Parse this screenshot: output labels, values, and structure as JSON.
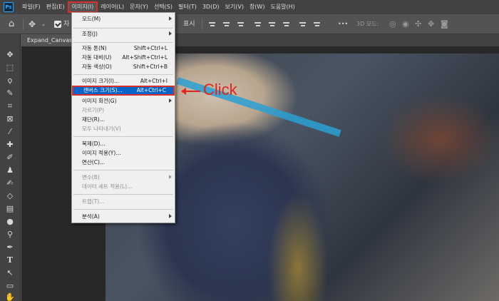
{
  "app": {
    "logo": "Ps"
  },
  "menubar": {
    "items": [
      {
        "label": "파일(F)"
      },
      {
        "label": "편집(E)"
      },
      {
        "label": "이미지(I)"
      },
      {
        "label": "레이어(L)"
      },
      {
        "label": "문자(Y)"
      },
      {
        "label": "선택(S)"
      },
      {
        "label": "필터(T)"
      },
      {
        "label": "3D(D)"
      },
      {
        "label": "보기(V)"
      },
      {
        "label": "창(W)"
      },
      {
        "label": "도움말(H)"
      }
    ],
    "active_index": 2
  },
  "options_bar": {
    "auto_select_label": "자",
    "transform_label": "표시",
    "mode_3d_label": "3D 모드:",
    "more_label": "•••"
  },
  "document": {
    "tab_title": "Expand_Canvas.jp"
  },
  "image_menu": {
    "mode": "모드(M)",
    "adjustments": "조정(J)",
    "auto_tone": {
      "label": "자동 톤(N)",
      "shortcut": "Shift+Ctrl+L"
    },
    "auto_contrast": {
      "label": "자동 대비(U)",
      "shortcut": "Alt+Shift+Ctrl+L"
    },
    "auto_color": {
      "label": "자동 색상(O)",
      "shortcut": "Shift+Ctrl+B"
    },
    "image_size": {
      "label": "이미지 크기(I)...",
      "shortcut": "Alt+Ctrl+I"
    },
    "canvas_size": {
      "label": "캔버스 크기(S)...",
      "shortcut": "Alt+Ctrl+C"
    },
    "image_rotation": "이미지 회전(G)",
    "crop": "자르기(P)",
    "trim": "재단(R)...",
    "reveal_all": "모두 나타내기(V)",
    "duplicate": "복제(D)...",
    "apply_image": "이미지 적용(Y)...",
    "calculations": "연산(C)...",
    "variables": "변수(B)",
    "apply_data_set": "데이터 세트 적용(L)...",
    "trap": "트랩(T)...",
    "analysis": "분석(A)"
  },
  "annotation": {
    "text": "Click",
    "color": "#e2231a"
  },
  "colors": {
    "highlight": "#0a64c8",
    "annotation_box": "#d9302c"
  }
}
